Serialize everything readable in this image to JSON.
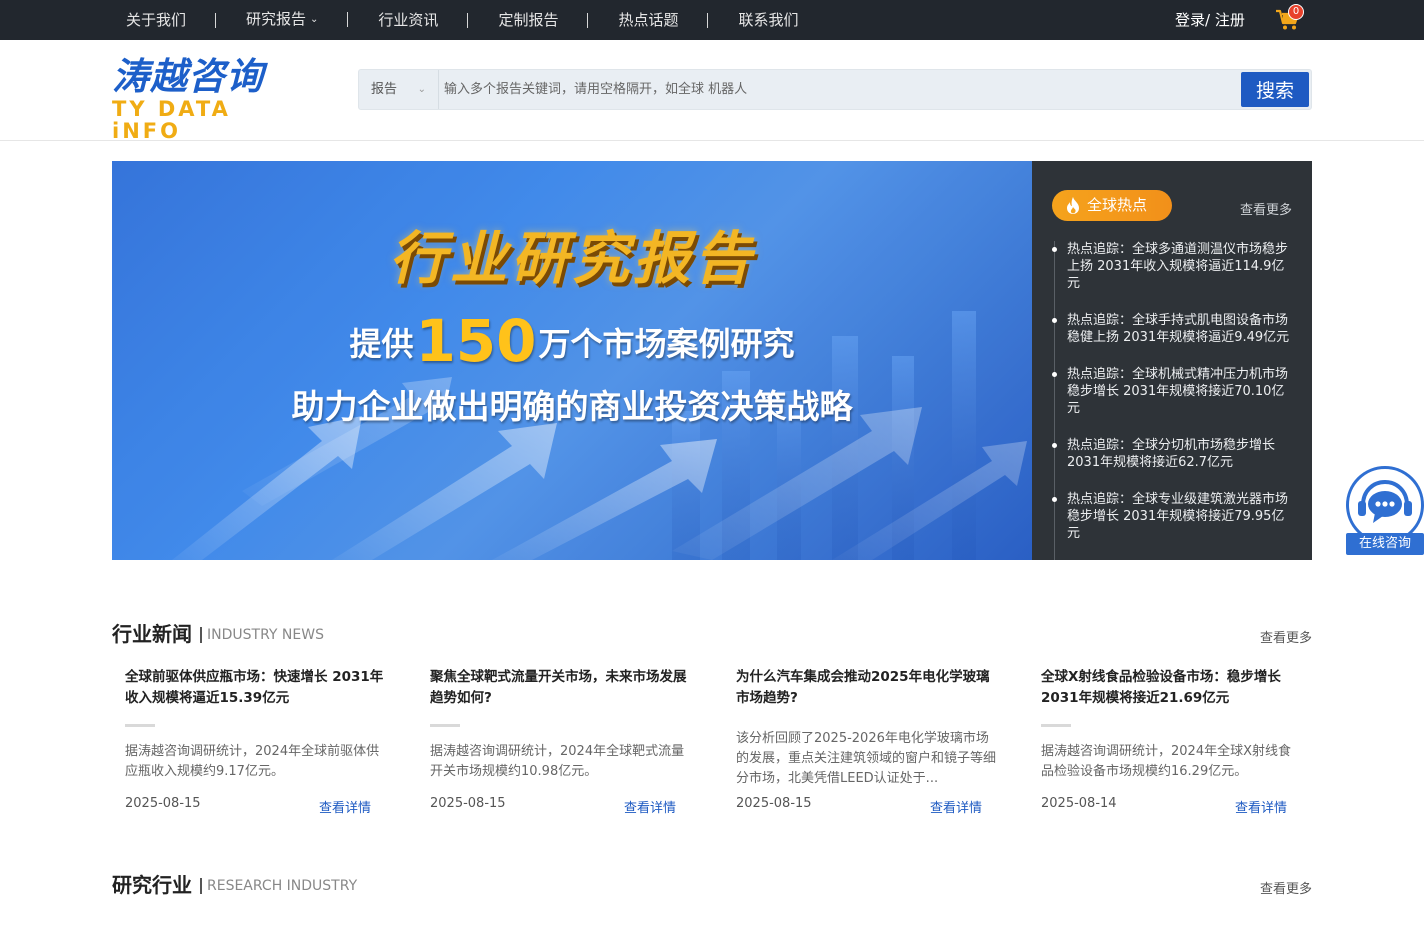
{
  "topnav": {
    "items": [
      "关于我们",
      "研究报告",
      "行业资讯",
      "定制报告",
      "热点话题",
      "联系我们"
    ],
    "login": "登录/ 注册",
    "cart_count": "0"
  },
  "logo": {
    "cn": "涛越咨询",
    "en": "TY DATA iNFO"
  },
  "search": {
    "category": "报告",
    "placeholder": "输入多个报告关键词，请用空格隔开，如全球 机器人",
    "button": "搜索"
  },
  "banner": {
    "title": "行业研究报告",
    "line1_pre": "提供",
    "line1_num": "150",
    "line1_post": "万个市场案例研究",
    "line2": "助力企业做出明确的商业投资决策战略"
  },
  "hot": {
    "tag": "全球热点",
    "more": "查看更多",
    "items": [
      "热点追踪：全球多通道测温仪市场稳步上扬 2031年收入规模将逼近114.9亿元",
      "热点追踪：全球手持式肌电图设备市场稳健上扬 2031年规模将逼近9.49亿元",
      "热点追踪：全球机械式精冲压力机市场稳步增长 2031年规模将接近70.10亿元",
      "热点追踪：全球分切机市场稳步增长 2031年规模将接近62.7亿元",
      "热点追踪：全球专业级建筑激光器市场稳步增长 2031年规模将接近79.95亿元"
    ]
  },
  "consult": {
    "label": "在线咨询"
  },
  "news": {
    "title": "行业新闻",
    "subtitle": "INDUSTRY NEWS",
    "more": "查看更多",
    "link_label": "查看详情",
    "items": [
      {
        "title": "全球前驱体供应瓶市场：快速增长 2031年收入规模将逼近15.39亿元",
        "desc": "据涛越咨询调研统计，2024年全球前驱体供应瓶收入规模约9.17亿元。",
        "date": "2025-08-15"
      },
      {
        "title": "聚焦全球靶式流量开关市场，未来市场发展趋势如何?",
        "desc": "据涛越咨询调研统计，2024年全球靶式流量开关市场规模约10.98亿元。",
        "date": "2025-08-15"
      },
      {
        "title": "为什么汽车集成会推动2025年电化学玻璃市场趋势?",
        "desc": "该分析回顾了2025-2026年电化学玻璃市场的发展，重点关注建筑领域的窗户和镜子等细分市场，北美凭借LEED认证处于...",
        "date": "2025-08-15"
      },
      {
        "title": "全球X射线食品检验设备市场：稳步增长 2031年规模将接近21.69亿元",
        "desc": "据涛越咨询调研统计，2024年全球X射线食品检验设备市场规模约16.29亿元。",
        "date": "2025-08-14"
      }
    ]
  },
  "research": {
    "title": "研究行业",
    "subtitle": "RESEARCH INDUSTRY",
    "more": "查看更多"
  },
  "colors": {
    "primary": "#1e5ac2",
    "accent": "#f5a31c",
    "topbar": "#22272e",
    "hot_bg": "#2e3338"
  }
}
